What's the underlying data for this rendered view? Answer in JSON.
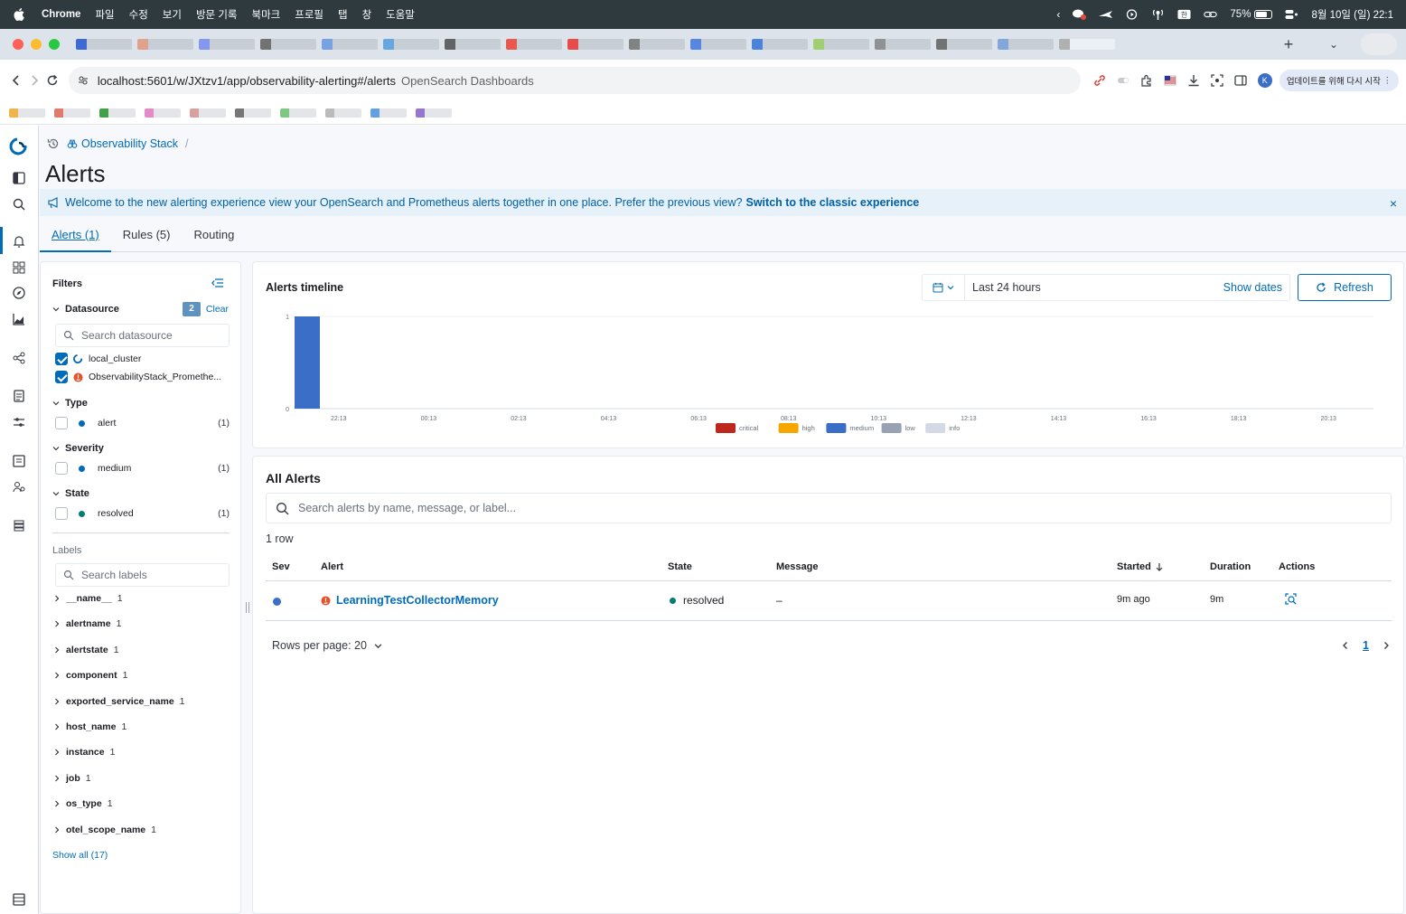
{
  "menubar": {
    "app_name": "Chrome",
    "menus": [
      "파일",
      "수정",
      "보기",
      "방문 기록",
      "북마크",
      "프로필",
      "탭",
      "창",
      "도움말"
    ],
    "battery": "75%",
    "battery_level": 0.75,
    "datetime": "8월 10일 (일) 22:1"
  },
  "browser": {
    "url": "localhost:5601/w/JXtzv1/app/observability-alerting#/alerts",
    "page_title": "OpenSearch Dashboards",
    "profile_initial": "K",
    "update_button": "업데이트를 위해 다시 시작"
  },
  "breadcrumb": {
    "workspace": "Observability Stack",
    "separator": "/"
  },
  "page": {
    "title": "Alerts"
  },
  "callout": {
    "text": "Welcome to the new alerting experience view your OpenSearch and Prometheus alerts together in one place. Prefer the previous view?",
    "link": "Switch to the classic experience",
    "close": "×"
  },
  "tabs": [
    {
      "label": "Alerts (1)",
      "selected": true
    },
    {
      "label": "Rules (5)",
      "selected": false
    },
    {
      "label": "Routing",
      "selected": false
    }
  ],
  "filters": {
    "title": "Filters",
    "datasource": {
      "title": "Datasource",
      "badge": "2",
      "clear": "Clear",
      "search_placeholder": "Search datasource",
      "items": [
        {
          "label": "local_cluster",
          "checked": true
        },
        {
          "label": "ObservabilityStack_Promethe...",
          "checked": true
        }
      ]
    },
    "type": {
      "title": "Type",
      "items": [
        {
          "label": "alert",
          "count": "(1)",
          "dot_color": "#006bb8"
        }
      ]
    },
    "severity": {
      "title": "Severity",
      "items": [
        {
          "label": "medium",
          "count": "(1)",
          "dot_color": "#006bb8"
        }
      ]
    },
    "state": {
      "title": "State",
      "items": [
        {
          "label": "resolved",
          "count": "(1)",
          "dot_color": "#017d73"
        }
      ]
    },
    "labels": {
      "title": "Labels",
      "search_placeholder": "Search labels",
      "items": [
        {
          "name": "__name__",
          "count": "1"
        },
        {
          "name": "alertname",
          "count": "1"
        },
        {
          "name": "alertstate",
          "count": "1"
        },
        {
          "name": "component",
          "count": "1"
        },
        {
          "name": "exported_service_name",
          "count": "1"
        },
        {
          "name": "host_name",
          "count": "1"
        },
        {
          "name": "instance",
          "count": "1"
        },
        {
          "name": "job",
          "count": "1"
        },
        {
          "name": "os_type",
          "count": "1"
        },
        {
          "name": "otel_scope_name",
          "count": "1"
        }
      ],
      "show_all": "Show all (17)"
    }
  },
  "timeline": {
    "title": "Alerts timeline",
    "range": "Last 24 hours",
    "show_dates": "Show dates",
    "refresh": "Refresh"
  },
  "chart_data": {
    "type": "bar",
    "title": "",
    "xlabel": "",
    "ylabel": "",
    "ylim": [
      0,
      1
    ],
    "yticks": [
      "1",
      "0"
    ],
    "x_ticks": [
      "22:13",
      "00:13",
      "02:13",
      "04:13",
      "06:13",
      "08:13",
      "10:13",
      "12:13",
      "14:13",
      "16:13",
      "18:13",
      "20:13"
    ],
    "series": [
      {
        "name": "critical",
        "color": "#bd271e",
        "points": []
      },
      {
        "name": "high",
        "color": "#f5a700",
        "points": []
      },
      {
        "name": "medium",
        "color": "#3b6ec6",
        "points": [
          {
            "x": "21:13",
            "y": 1
          }
        ]
      },
      {
        "name": "low",
        "color": "#98a2b3",
        "points": []
      },
      {
        "name": "info",
        "color": "#d3dae6",
        "points": []
      }
    ],
    "legend_position": "bottom-center",
    "grid": true
  },
  "alerts_table": {
    "title": "All Alerts",
    "search_placeholder": "Search alerts by name, message, or label...",
    "row_count": "1 row",
    "columns": [
      "Sev",
      "Alert",
      "State",
      "Message",
      "Started",
      "Duration",
      "Actions"
    ],
    "rows": [
      {
        "severity_color": "#3b6ec6",
        "alert": "LearningTestCollectorMemory",
        "state": "resolved",
        "state_color": "#017d73",
        "message": "–",
        "started": "9m ago",
        "duration": "9m"
      }
    ],
    "rows_per_page": "Rows per page: 20",
    "current_page": "1"
  }
}
